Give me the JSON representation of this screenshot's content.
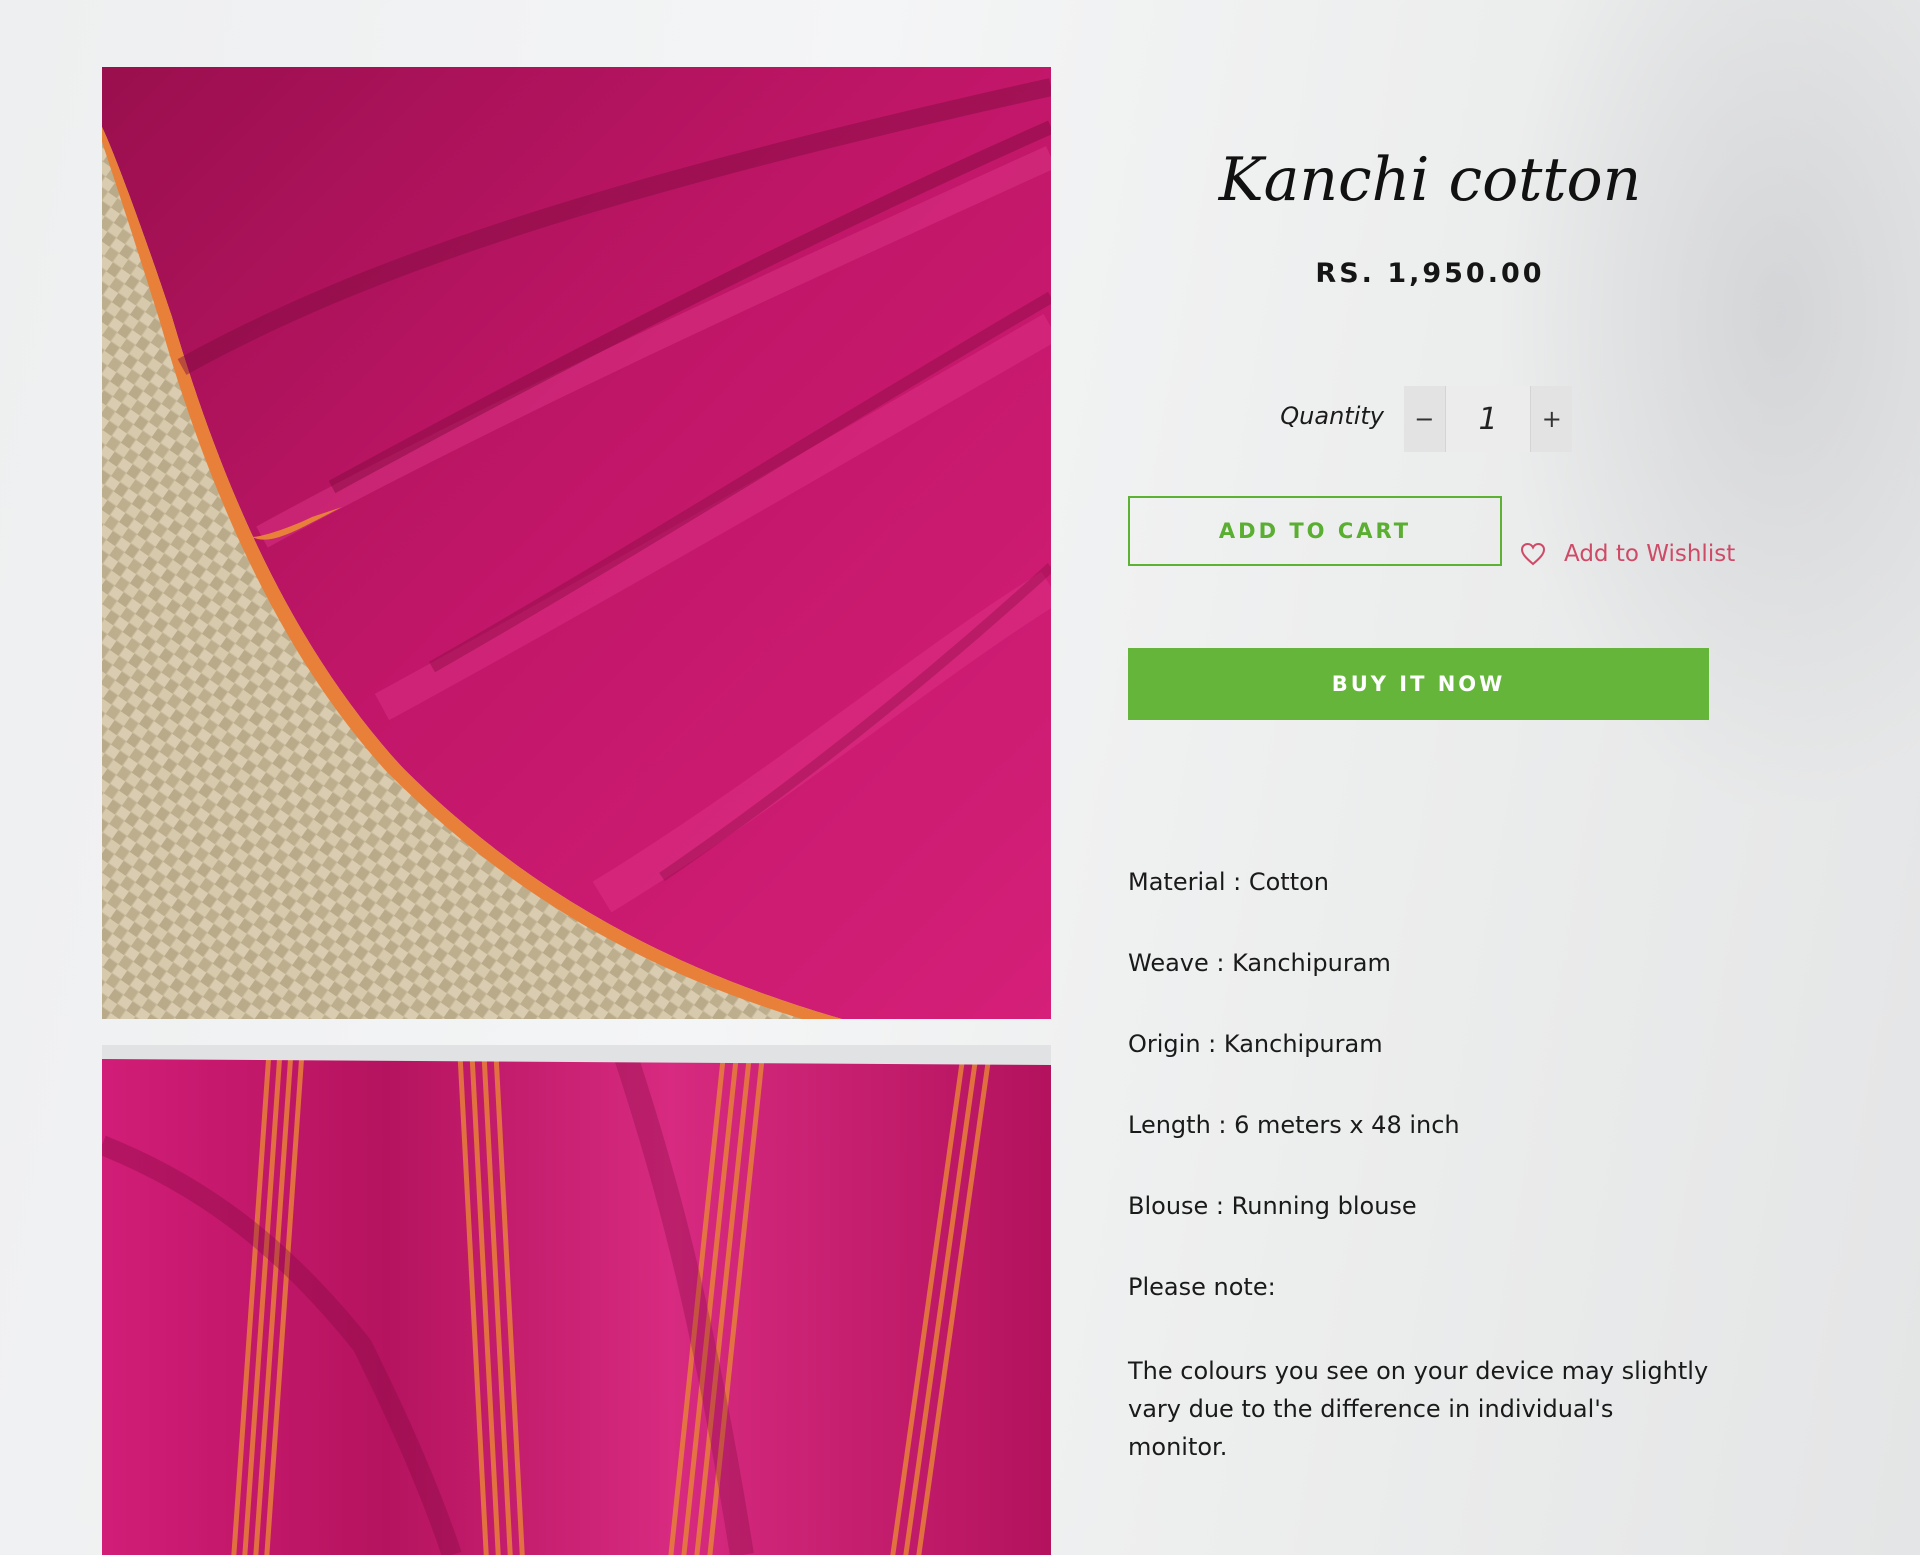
{
  "product": {
    "title": "Kanchi cotton",
    "price": "RS. 1,950.00",
    "images": [
      {
        "subject": "magenta cotton saree with orange border on woven mat"
      },
      {
        "subject": "magenta saree with orange stripes"
      }
    ]
  },
  "quantity": {
    "label": "Quantity",
    "value": "1",
    "decrement": "−",
    "increment": "+"
  },
  "actions": {
    "add_to_cart": "ADD TO CART",
    "wishlist": "Add to Wishlist",
    "wishlist_icon": "heart-icon",
    "buy_now": "BUY IT NOW"
  },
  "details": [
    "Material : Cotton",
    "Weave : Kanchipuram",
    "Origin : Kanchipuram",
    "Length : 6 meters x 48 inch",
    "Blouse : Running blouse",
    "Please note:"
  ],
  "note": "The colours you see on your device may slightly vary due to the difference in individual's monitor.",
  "colors": {
    "accent_green": "#66b53b",
    "wishlist_pink": "#cf4a67",
    "saree_magenta": "#c4186f",
    "border_orange": "#e8803a"
  }
}
